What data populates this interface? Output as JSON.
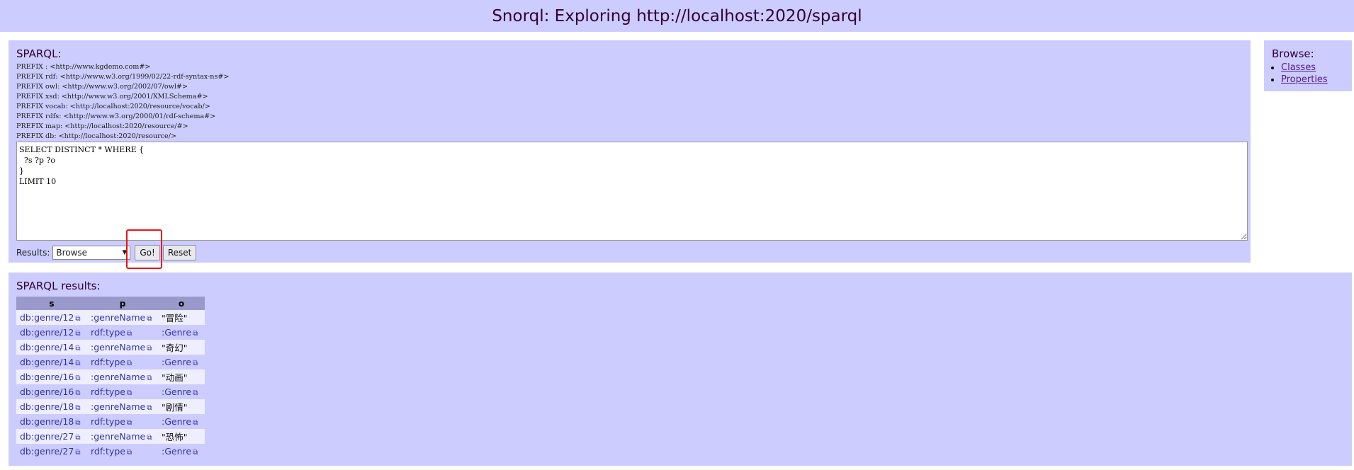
{
  "header": {
    "title": "Snorql: Exploring http://localhost:2020/sparql"
  },
  "sparql": {
    "title": "SPARQL:",
    "prefixes": [
      "PREFIX : <http://www.kgdemo.com#>",
      "PREFIX rdf: <http://www.w3.org/1999/02/22-rdf-syntax-ns#>",
      "PREFIX owl: <http://www.w3.org/2002/07/owl#>",
      "PREFIX xsd: <http://www.w3.org/2001/XMLSchema#>",
      "PREFIX vocab: <http://localhost:2020/resource/vocab/>",
      "PREFIX rdfs: <http://www.w3.org/2000/01/rdf-schema#>",
      "PREFIX map: <http://localhost:2020/resource/#>",
      "PREFIX db: <http://localhost:2020/resource/>"
    ],
    "query": "SELECT DISTINCT * WHERE {\n  ?s ?p ?o\n}\nLIMIT 10",
    "results_label": "Results:",
    "results_select": "Browse",
    "go_label": "Go!",
    "reset_label": "Reset"
  },
  "browse": {
    "title": "Browse:",
    "items": [
      "Classes",
      "Properties"
    ]
  },
  "results": {
    "title": "SPARQL results:",
    "columns": [
      "s",
      "p",
      "o"
    ],
    "rows": [
      {
        "s": "db:genre/12",
        "p": ":genreName",
        "o": "\"冒险\"",
        "o_link": false
      },
      {
        "s": "db:genre/12",
        "p": "rdf:type",
        "o": ":Genre",
        "o_link": true
      },
      {
        "s": "db:genre/14",
        "p": ":genreName",
        "o": "\"奇幻\"",
        "o_link": false
      },
      {
        "s": "db:genre/14",
        "p": "rdf:type",
        "o": ":Genre",
        "o_link": true
      },
      {
        "s": "db:genre/16",
        "p": ":genreName",
        "o": "\"动画\"",
        "o_link": false
      },
      {
        "s": "db:genre/16",
        "p": "rdf:type",
        "o": ":Genre",
        "o_link": true
      },
      {
        "s": "db:genre/18",
        "p": ":genreName",
        "o": "\"剧情\"",
        "o_link": false
      },
      {
        "s": "db:genre/18",
        "p": "rdf:type",
        "o": ":Genre",
        "o_link": true
      },
      {
        "s": "db:genre/27",
        "p": ":genreName",
        "o": "\"恐怖\"",
        "o_link": false
      },
      {
        "s": "db:genre/27",
        "p": "rdf:type",
        "o": ":Genre",
        "o_link": true
      }
    ]
  }
}
